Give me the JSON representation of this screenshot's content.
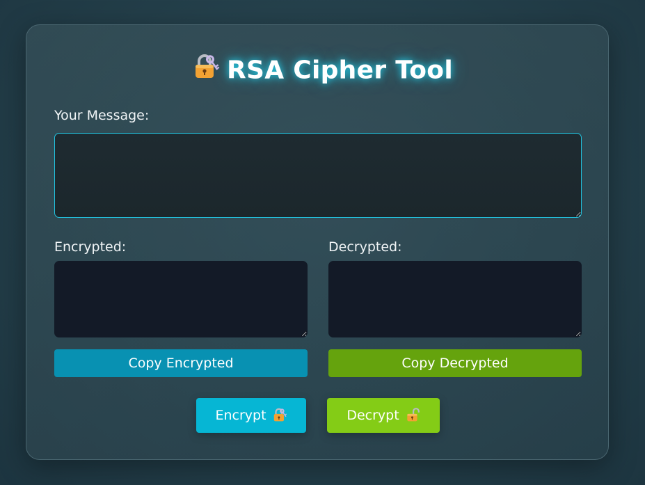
{
  "header": {
    "title": "RSA Cipher Tool",
    "icon": "locked-with-key-icon"
  },
  "message": {
    "label": "Your Message:",
    "value": "",
    "placeholder": ""
  },
  "encrypted": {
    "label": "Encrypted:",
    "value": "",
    "copy_label": "Copy Encrypted"
  },
  "decrypted": {
    "label": "Decrypted:",
    "value": "",
    "copy_label": "Copy Decrypted"
  },
  "actions": {
    "encrypt_label": "Encrypt",
    "encrypt_icon": "locked-with-key-icon",
    "decrypt_label": "Decrypt",
    "decrypt_icon": "unlocked-icon"
  },
  "colors": {
    "accent_cyan": "#06b6d4",
    "accent_green": "#84cc16",
    "copy_encrypted_bg": "#0891b2",
    "copy_decrypted_bg": "#65a30d",
    "output_bg": "#131a27"
  }
}
